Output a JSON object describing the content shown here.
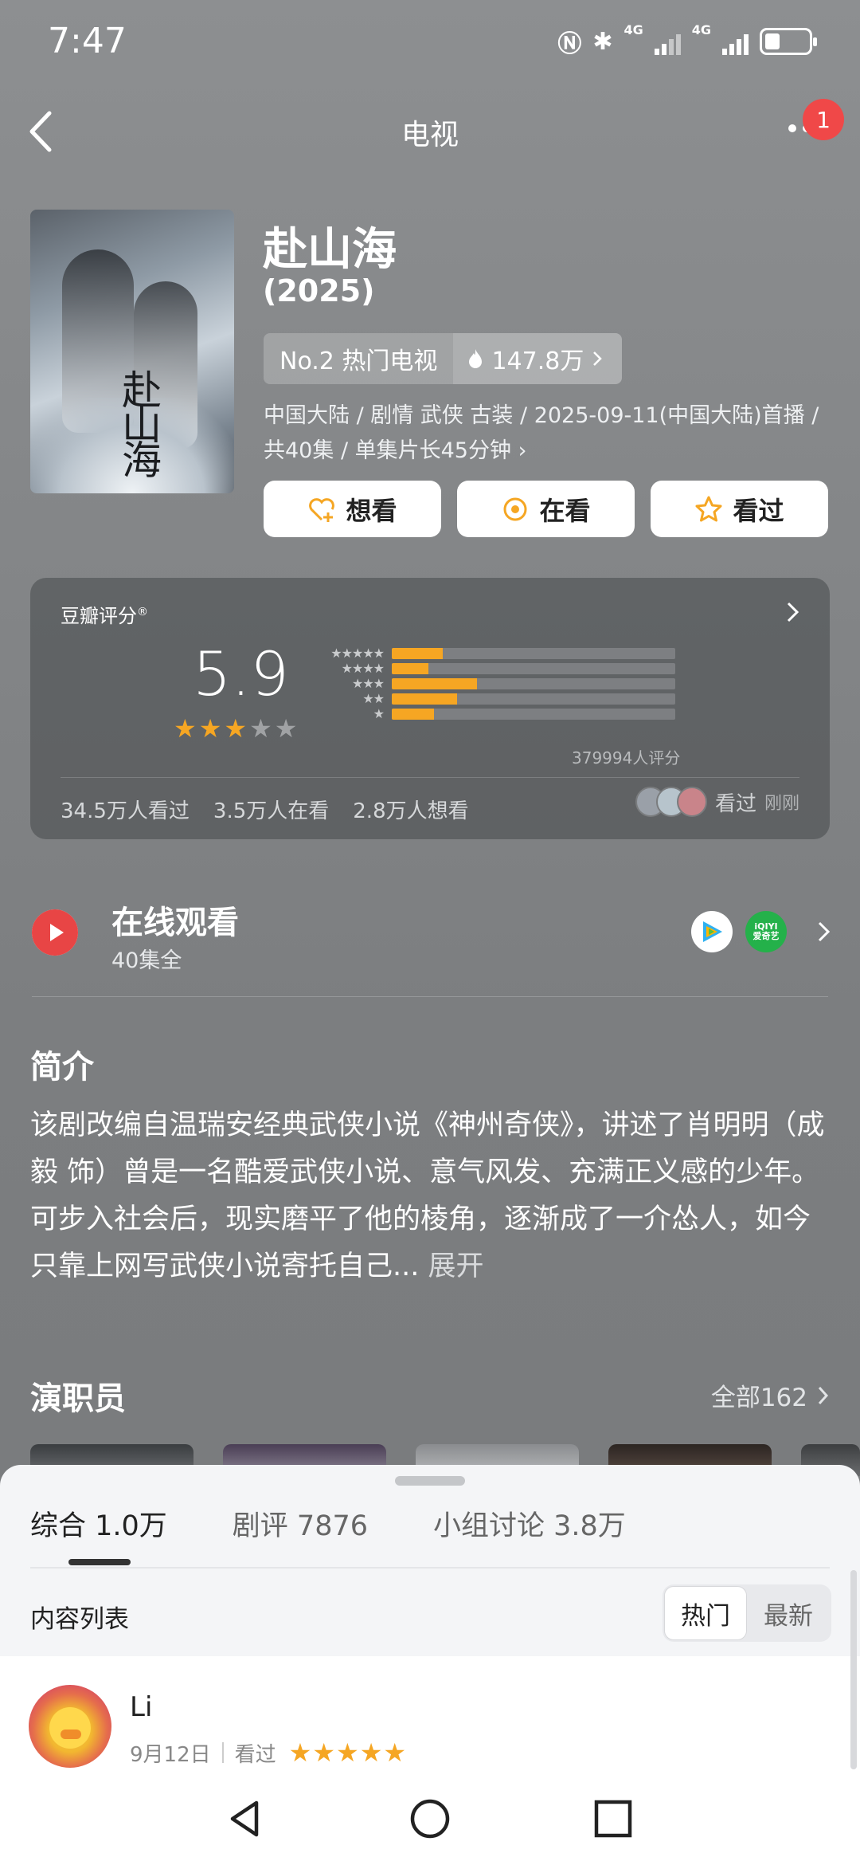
{
  "status_bar": {
    "time": "7:47",
    "net1": "4G",
    "net2": "4G"
  },
  "nav": {
    "title": "电视",
    "badge": "1"
  },
  "poster": {
    "title_text": "赴山海"
  },
  "header": {
    "title": "赴山海",
    "year": "(2025)",
    "rank": "No.2 热门电视",
    "heat": "147.8万",
    "meta": "中国大陆 / 剧情 武侠 古装 / 2025-09-11(中国大陆)首播 / 共40集 / 单集片长45分钟"
  },
  "actions": [
    {
      "label": "想看",
      "icon": "heart-plus-icon"
    },
    {
      "label": "在看",
      "icon": "target-icon"
    },
    {
      "label": "看过",
      "icon": "star-icon"
    }
  ],
  "rating": {
    "label": "豆瓣评分",
    "registered": "®",
    "score": "5.9",
    "stars_filled": 3,
    "stars_total": 5,
    "distribution": [
      {
        "stars": "★★★★★",
        "fraction": 0.18
      },
      {
        "stars": "★★★★",
        "fraction": 0.13
      },
      {
        "stars": "★★★",
        "fraction": 0.3
      },
      {
        "stars": "★★",
        "fraction": 0.23
      },
      {
        "stars": "★",
        "fraction": 0.15
      }
    ],
    "vote_count": "379994人评分",
    "stats": [
      "34.5万人看过",
      "3.5万人在看",
      "2.8万人想看"
    ],
    "seen_label": "看过",
    "seen_time": "刚刚"
  },
  "watch": {
    "title": "在线观看",
    "subtitle": "40集全",
    "platforms": [
      "tencent-video",
      "iqiyi"
    ],
    "iqiyi_text": "iQIYI",
    "iqiyi_cn": "爱奇艺"
  },
  "intro": {
    "title": "简介",
    "text": "该剧改编自温瑞安经典武侠小说《神州奇侠》，讲述了肖明明（成毅 饰）曾是一名酷爱武侠小说、意气风发、充满正义感的少年。可步入社会后，现实磨平了他的棱角，逐渐成了一介怂人，如今只靠上网写武侠小说寄托自己...",
    "expand": "展开"
  },
  "cast": {
    "title": "演职员",
    "all": "全部162"
  },
  "sheet": {
    "tabs": [
      "综合 1.0万",
      "剧评 7876",
      "小组讨论 3.8万"
    ],
    "list_label": "内容列表",
    "sort_options": [
      "热门",
      "最新"
    ]
  },
  "review": {
    "name": "Li",
    "date": "9月12日",
    "status": "看过",
    "stars": "★★★★★"
  },
  "colors": {
    "accent_orange": "#f5a623",
    "badge_red": "#f04848",
    "play_red": "#e84545"
  }
}
